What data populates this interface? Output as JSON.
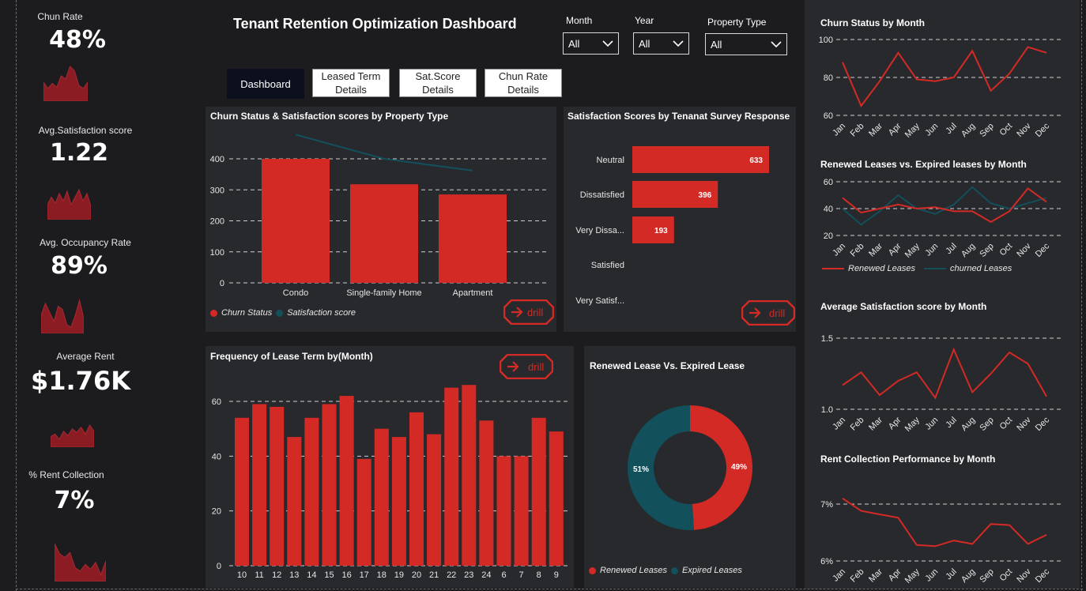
{
  "title": "Tenant Retention Optimization Dashboard",
  "colors": {
    "red": "#d42a25",
    "teal": "#12505c",
    "bg": "#1c1c1f",
    "panel": "#28292d",
    "spark": "#8c1c24"
  },
  "kpis": [
    {
      "label": "Chun Rate",
      "value": "48%",
      "spark": [
        30,
        20,
        28,
        22,
        40,
        35,
        55,
        48,
        25,
        20,
        30
      ]
    },
    {
      "label": "Avg.Satisfaction score",
      "value": "1.22",
      "spark": [
        20,
        30,
        22,
        35,
        25,
        38,
        20,
        30,
        40,
        25,
        35,
        18
      ]
    },
    {
      "label": "Avg. Occupancy Rate",
      "value": "89%",
      "spark": [
        30,
        50,
        35,
        20,
        45,
        40,
        15,
        10,
        30,
        55,
        25
      ]
    },
    {
      "label": "Average Rent",
      "value": "$1.76K",
      "spark": [
        20,
        25,
        15,
        30,
        22,
        35,
        28,
        38,
        25,
        42,
        30
      ]
    },
    {
      "label": "% Rent Collection",
      "value": "7%",
      "spark": [
        55,
        40,
        35,
        42,
        20,
        15,
        25,
        18,
        28,
        10,
        30
      ]
    }
  ],
  "filters": [
    {
      "label": "Month",
      "value": "All"
    },
    {
      "label": "Year",
      "value": "All"
    },
    {
      "label": "Property Type",
      "value": "All"
    }
  ],
  "nav": [
    {
      "label": "Dashboard"
    },
    {
      "label": "Leased Term Details"
    },
    {
      "label": "Sat.Score Details"
    },
    {
      "label": "Chun Rate Details"
    }
  ],
  "drill_label": "drill",
  "panels": {
    "property": "Churn Status & Satisfaction scores by Property Type",
    "survey": "Satisfaction Scores by Tenanat Survey Response",
    "leaseterm": "Frequency of Lease Term by(Month)",
    "donut": "Renewed Lease Vs. Expired Lease",
    "churn_month": "Churn Status by Month",
    "renew_month": "Renewed Leases vs. Expired leases by Month",
    "sat_month": "Average Satisfaction score by Month",
    "rent_month": "Rent Collection Performance by Month"
  },
  "legends": {
    "property": [
      "Churn Status",
      "Satisfaction score"
    ],
    "renew": [
      "Renewed Leases",
      "churned Leases"
    ],
    "donut": [
      "Renewed Leases",
      "Expired Leases"
    ]
  },
  "chart_data": [
    {
      "type": "bar",
      "title": "Churn Status & Satisfaction scores by Property Type",
      "categories": [
        "Condo",
        "Single-family Home",
        "Apartment"
      ],
      "series": [
        {
          "name": "Churn Status",
          "values": [
            400,
            318,
            285
          ]
        },
        {
          "name": "Satisfaction score",
          "values": [
            478,
            400,
            362
          ]
        }
      ],
      "yticks": [
        "0",
        "100",
        "200",
        "300",
        "400"
      ],
      "ylim": [
        0,
        450
      ]
    },
    {
      "type": "bar",
      "title": "Satisfaction Scores by Tenanat Survey Response",
      "categories": [
        "Neutral",
        "Dissatisfied",
        "Very Dissa...",
        "Satisfied",
        "Very Satisf..."
      ],
      "values": [
        633,
        396,
        193,
        null,
        null
      ],
      "value_labels": [
        "633",
        "396",
        "193",
        "",
        ""
      ]
    },
    {
      "type": "bar",
      "title": "Frequency of Lease Term by(Month)",
      "categories": [
        "10",
        "11",
        "12",
        "13",
        "14",
        "15",
        "16",
        "17",
        "18",
        "19",
        "20",
        "21",
        "22",
        "23",
        "24",
        "6",
        "7",
        "8",
        "9"
      ],
      "values": [
        54,
        59,
        58,
        47,
        54,
        59,
        62,
        39,
        50,
        47,
        56,
        48,
        65,
        66,
        53,
        40,
        40,
        54,
        49
      ],
      "yticks": [
        "0",
        "20",
        "40",
        "60"
      ],
      "ylim": [
        0,
        68
      ]
    },
    {
      "type": "pie",
      "title": "Renewed Lease Vs. Expired Lease",
      "categories": [
        "Renewed Leases",
        "Expired Leases"
      ],
      "values": [
        49,
        51
      ],
      "value_labels": [
        "49%",
        "51%"
      ]
    },
    {
      "type": "line",
      "title": "Churn Status by Month",
      "categories": [
        "Jan",
        "Feb",
        "Mar",
        "Apr",
        "May",
        "Jun",
        "Jul",
        "Aug",
        "Sep",
        "Oct",
        "Nov",
        "Dec"
      ],
      "values": [
        88,
        65,
        78,
        93,
        79,
        78,
        80,
        94,
        73,
        82,
        96,
        93
      ],
      "yticks": [
        "60",
        "80",
        "100"
      ],
      "ylim": [
        60,
        100
      ]
    },
    {
      "type": "line",
      "title": "Renewed Leases vs. Expired leases by Month",
      "categories": [
        "Jan",
        "Feb",
        "Mar",
        "Apr",
        "May",
        "Jun",
        "Jul",
        "Aug",
        "Sep",
        "Oct",
        "Nov",
        "Dec"
      ],
      "series": [
        {
          "name": "Renewed Leases",
          "values": [
            48,
            37,
            40,
            43,
            40,
            41,
            38,
            38,
            30,
            38,
            55,
            45
          ]
        },
        {
          "name": "churned Leases",
          "values": [
            40,
            28,
            38,
            50,
            40,
            36,
            43,
            56,
            44,
            40,
            44,
            48
          ]
        }
      ],
      "yticks": [
        "20",
        "40",
        "60"
      ],
      "ylim": [
        20,
        60
      ]
    },
    {
      "type": "line",
      "title": "Average Satisfaction score by Month",
      "categories": [
        "Jan",
        "Feb",
        "Mar",
        "Apr",
        "May",
        "Jun",
        "Jul",
        "Aug",
        "Sep",
        "Oct",
        "Nov",
        "Dec"
      ],
      "values": [
        1.17,
        1.26,
        1.1,
        1.2,
        1.26,
        1.08,
        1.42,
        1.12,
        1.25,
        1.4,
        1.32,
        1.09
      ],
      "yticks": [
        "1.0",
        "1.5"
      ],
      "ylim": [
        1.0,
        1.5
      ]
    },
    {
      "type": "line",
      "title": "Rent Collection Performance by Month",
      "categories": [
        "Jan",
        "Feb",
        "Mar",
        "Apr",
        "May",
        "Jun",
        "Jul",
        "Aug",
        "Sep",
        "Oct",
        "Nov",
        "Dec"
      ],
      "values": [
        7.1,
        6.88,
        6.82,
        6.76,
        6.28,
        6.26,
        6.36,
        6.3,
        6.65,
        6.63,
        6.3,
        6.46
      ],
      "yticks": [
        "6%",
        "7%"
      ],
      "ylim": [
        6.0,
        7.0
      ]
    }
  ]
}
